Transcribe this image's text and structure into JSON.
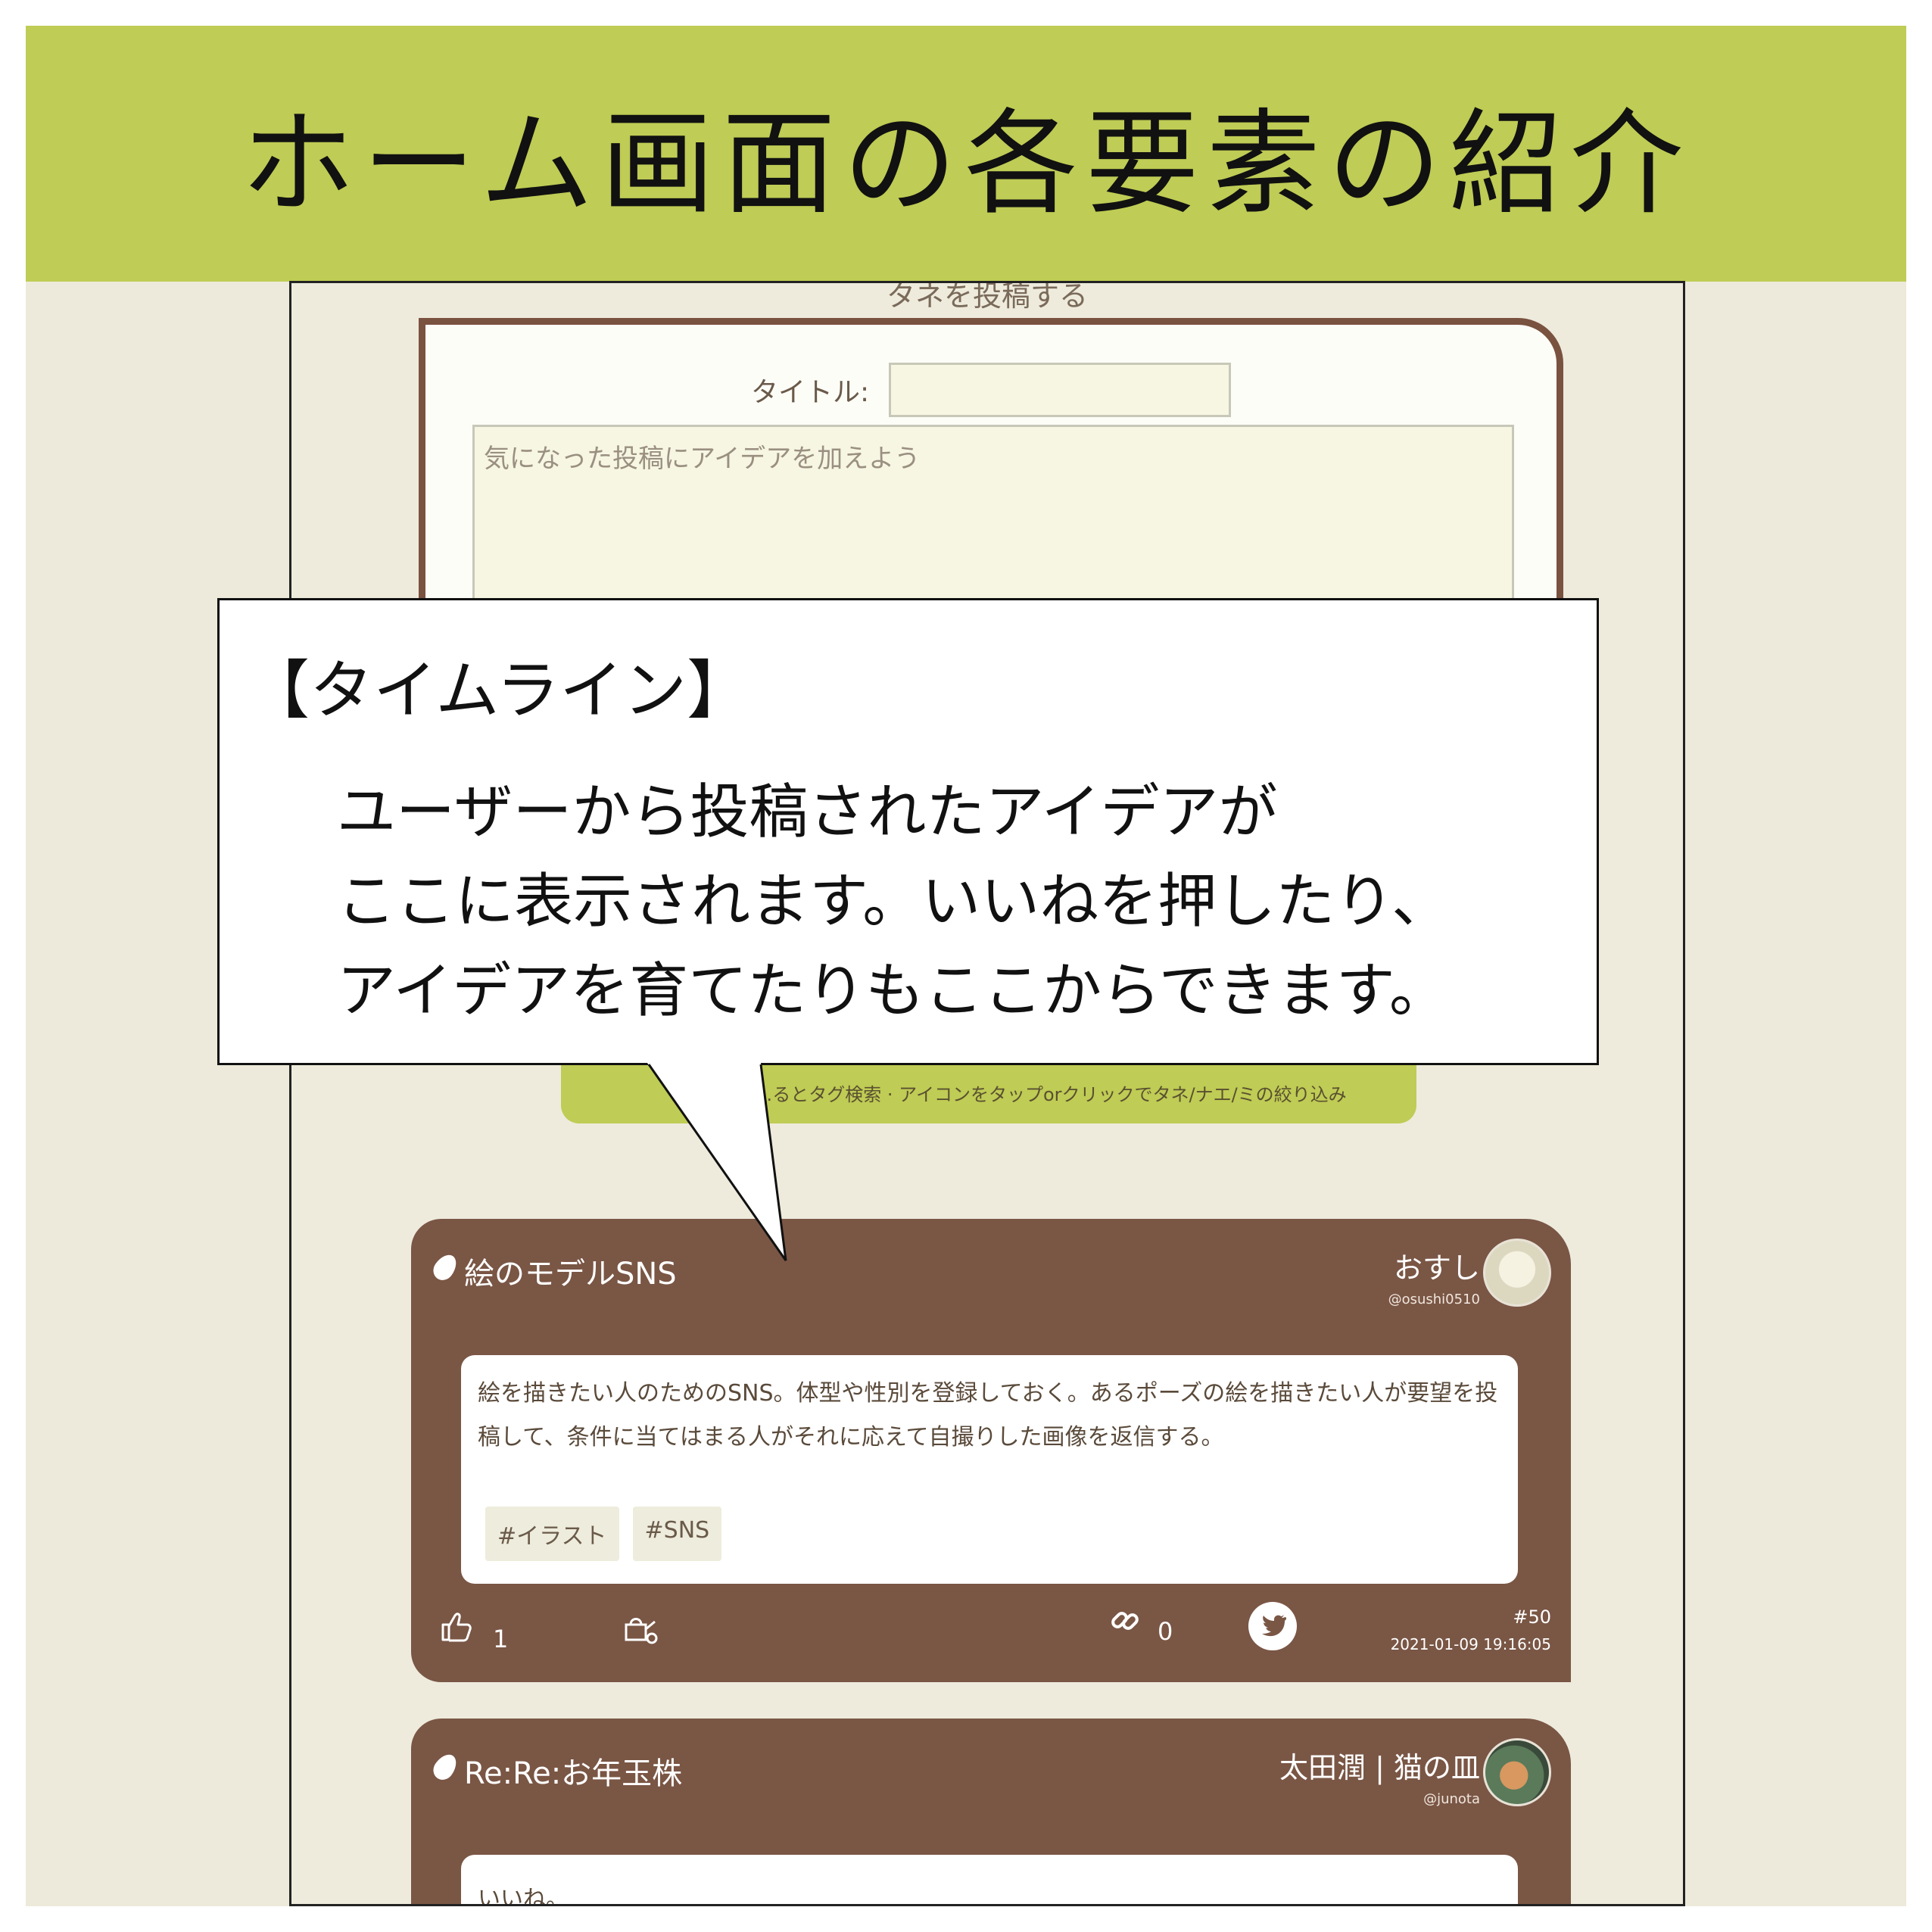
{
  "header": {
    "title": "ホーム画面の各要素の紹介"
  },
  "post_form": {
    "heading": "タネを投稿する",
    "title_label": "タイトル:",
    "title_value": "",
    "body_placeholder": "気になった投稿にアイデアを加えよう"
  },
  "tag_search": {
    "hint": "· …るとタグ検索 · アイコンをタップorクリックでタネ/ナエ/ミの絞り込み"
  },
  "timeline": [
    {
      "title": "絵のモデルSNS",
      "user_name": "おすし",
      "user_handle": "@osushi0510",
      "body": "絵を描きたい人のためのSNS。体型や性別を登録しておく。あるポーズの絵を描きたい人が要望を投稿して、条件に当てはまる人がそれに応えて自撮りした画像を返信する。",
      "tags": [
        "#イラスト",
        "#SNS"
      ],
      "like_count": "1",
      "link_count": "0",
      "post_number": "#50",
      "timestamp": "2021-01-09 19:16:05"
    },
    {
      "title": "Re:Re:お年玉株",
      "user_name": "太田潤 | 猫の皿",
      "user_handle": "@junota",
      "body": "いいね。"
    }
  ],
  "callout": {
    "heading": "【タイムライン】",
    "lines": [
      "ユーザーから投稿されたアイデアが",
      "ここに表示されます。いいねを押したり、",
      "アイデアを育てたりもここからできます。"
    ]
  },
  "colors": {
    "header_bg": "#bfcc55",
    "page_bg": "#edeadb",
    "card_bg": "#7a5645",
    "form_border": "#7a5240"
  },
  "icons": {
    "seed": "seed-icon",
    "like": "thumbs-up-icon",
    "grow": "watering-can-icon",
    "link": "link-icon",
    "share": "twitter-icon"
  }
}
